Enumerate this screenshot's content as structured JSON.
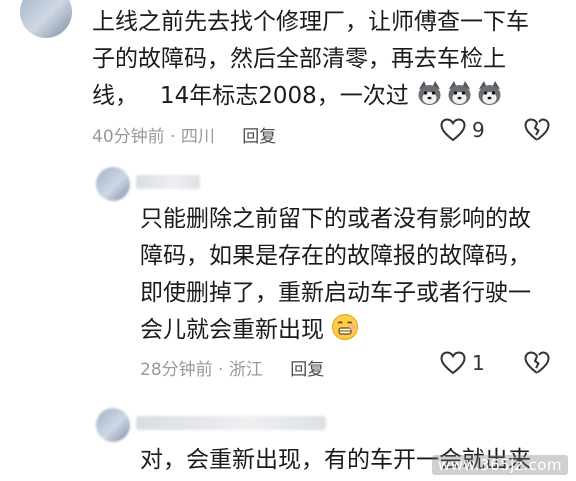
{
  "comments": [
    {
      "lines": [
        "上线之前先去找个修理厂，让师傅查一下车",
        "子的故障码，然后全部清零，再去车检上",
        "线，   14年标志2008，一次过"
      ],
      "time": "40分钟前 · 四川",
      "reply": "回复",
      "likes": "9",
      "emoji": "husky-emoji"
    },
    {
      "lines": [
        "只能删除之前留下的或者没有影响的故",
        "障码，如果是存在的故障报的故障码，",
        "即使删掉了，重新启动车子或者行驶一",
        "会儿就会重新出现"
      ],
      "time": "28分钟前 · 浙江",
      "reply": "回复",
      "likes": "1",
      "emoji": "grimace-emoji"
    },
    {
      "lines": [
        "对，会重新出现，有的车开一会就出来"
      ]
    }
  ],
  "watermark": "www.365jz.com",
  "colors": {
    "meta": "#9a9a9a",
    "text": "#1b1b1b",
    "icon": "#333333"
  }
}
